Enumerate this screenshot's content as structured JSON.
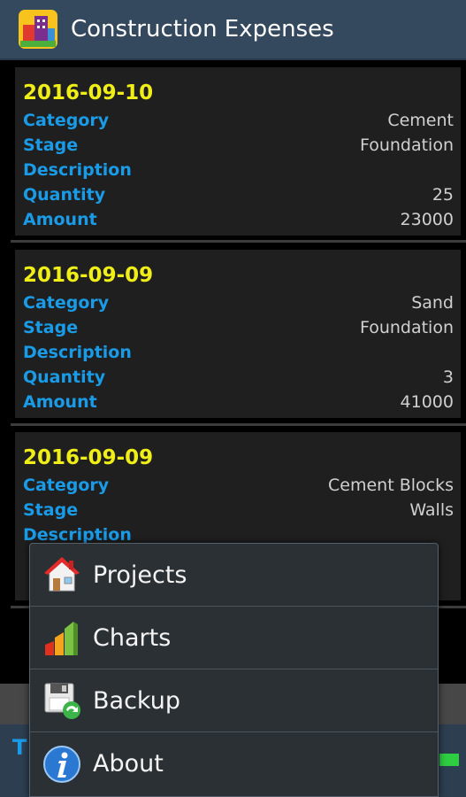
{
  "app": {
    "title": "Construction Expenses"
  },
  "labels": {
    "category": "Category",
    "stage": "Stage",
    "description": "Description",
    "quantity": "Quantity",
    "amount": "Amount"
  },
  "expenses": [
    {
      "date": "2016-09-10",
      "category": "Cement",
      "stage": "Foundation",
      "description": "",
      "quantity": "25",
      "amount": "23000"
    },
    {
      "date": "2016-09-09",
      "category": "Sand",
      "stage": "Foundation",
      "description": "",
      "quantity": "3",
      "amount": "41000"
    },
    {
      "date": "2016-09-09",
      "category": "Cement Blocks",
      "stage": "Walls",
      "description": "",
      "quantity": "",
      "amount": ""
    }
  ],
  "background_bar": {
    "letter": "T"
  },
  "menu": {
    "items": [
      {
        "label": "Projects",
        "icon": "house-icon"
      },
      {
        "label": "Charts",
        "icon": "bar-chart-icon"
      },
      {
        "label": "Backup",
        "icon": "floppy-disk-icon"
      },
      {
        "label": "About",
        "icon": "info-icon"
      }
    ]
  },
  "colors": {
    "appbar": "#34495e",
    "date": "#f0ee18",
    "label": "#1a9be8",
    "value": "#d0d0d0",
    "menu_bg": "#2b3035"
  }
}
